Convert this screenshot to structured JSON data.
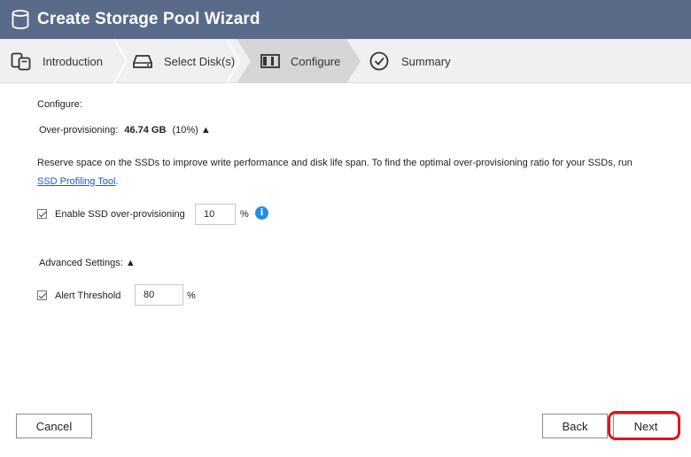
{
  "window": {
    "title": "Create Storage Pool Wizard",
    "icon": "database-icon"
  },
  "steps": [
    {
      "label": "Introduction",
      "icon": "nas-icon",
      "active": false
    },
    {
      "label": "Select Disk(s)",
      "icon": "disk-icon",
      "active": false
    },
    {
      "label": "Configure",
      "icon": "configure-icon",
      "active": true
    },
    {
      "label": "Summary",
      "icon": "check-circle-icon",
      "active": false
    }
  ],
  "content": {
    "section_label": "Configure:",
    "overprovisioning_label": "Over-provisioning:",
    "overprovisioning_value": "46.74 GB",
    "overprovisioning_percent": "(10%)",
    "expand_glyph": "▲",
    "description": "Reserve space on the SSDs to improve write performance and disk life span. To find the optimal over-provisioning ratio for your SSDs, run",
    "link_text": "SSD Profiling Tool",
    "link_suffix": ".",
    "enable_ssd": {
      "label": "Enable SSD over-provisioning",
      "checked": true,
      "value": "10",
      "unit": "%"
    },
    "advanced_label": "Advanced Settings:",
    "alert_threshold": {
      "label": "Alert Threshold",
      "checked": true,
      "value": "80",
      "unit": "%"
    }
  },
  "footer": {
    "cancel_label": "Cancel",
    "back_label": "Back",
    "next_label": "Next"
  },
  "colors": {
    "titlebar": "#5a6b8a",
    "steps_bg": "#f0f0f0",
    "active_step_bg": "#d6d6d6",
    "link": "#1a56d6",
    "info": "#1e8fe6",
    "highlight": "#e0141c"
  }
}
